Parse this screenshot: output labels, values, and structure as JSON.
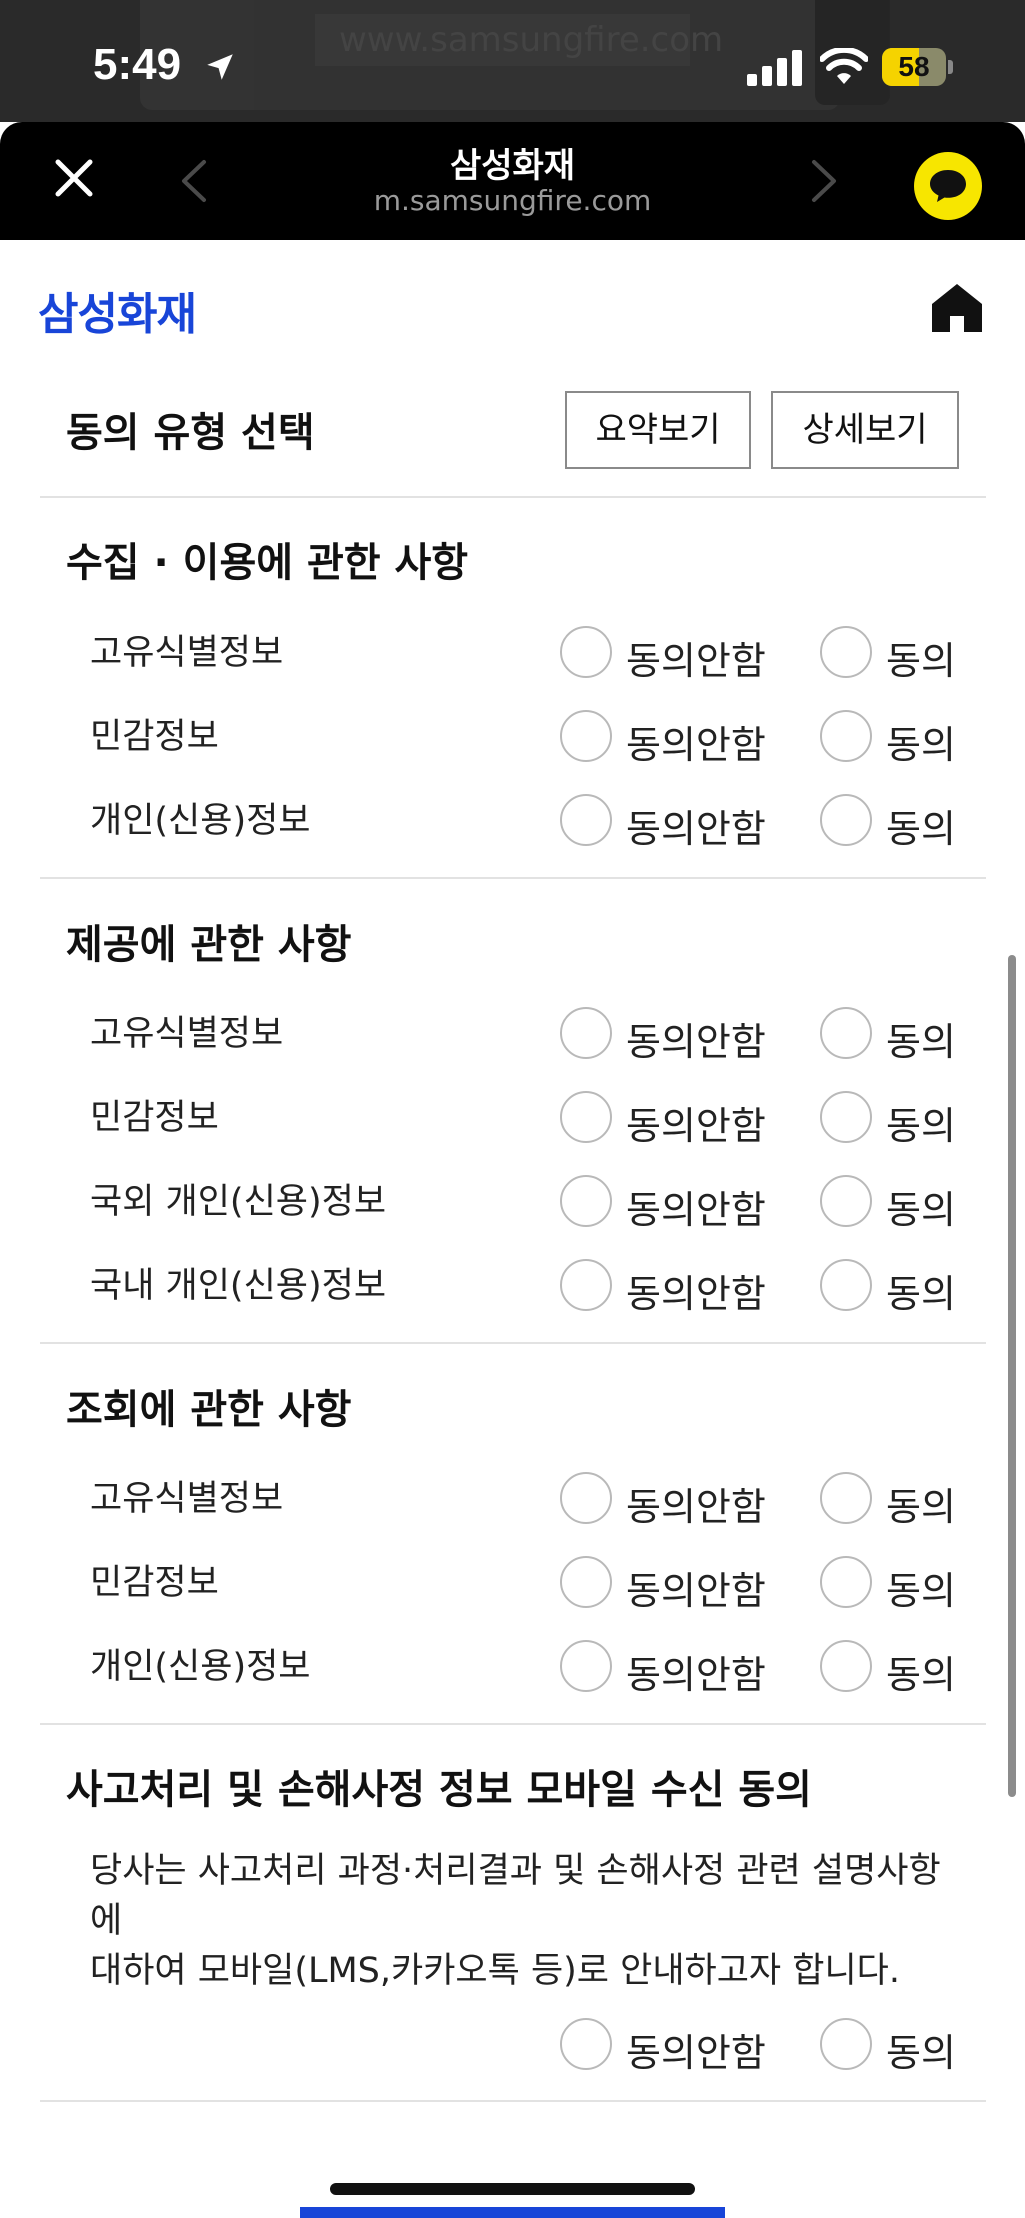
{
  "status_bar": {
    "time": "5:49",
    "battery_percent": "58",
    "battery_level": 0.58,
    "ghost_url": "www.samsungfire.com"
  },
  "browser": {
    "title": "삼성화재",
    "url": "m.samsungfire.com",
    "accent_color": "#f7e600"
  },
  "page": {
    "logo": "삼성화재",
    "brand_color": "#1845d8"
  },
  "consent_type": {
    "title": "동의 유형 선택",
    "summary_button": "요약보기",
    "detail_button": "상세보기"
  },
  "options": {
    "disagree": "동의안함",
    "agree": "동의"
  },
  "sections": [
    {
      "title": "수집 · 이용에 관한 사항",
      "rows": [
        "고유식별정보",
        "민감정보",
        "개인(신용)정보"
      ]
    },
    {
      "title": "제공에 관한 사항",
      "rows": [
        "고유식별정보",
        "민감정보",
        "국외 개인(신용)정보",
        "국내 개인(신용)정보"
      ]
    },
    {
      "title": "조회에 관한 사항",
      "rows": [
        "고유식별정보",
        "민감정보",
        "개인(신용)정보"
      ]
    }
  ],
  "mobile_consent": {
    "title": "사고처리 및 손해사정 정보 모바일 수신 동의",
    "notice_line1": "당사는 사고처리 과정·처리결과 및 손해사정 관련 설명사항에",
    "notice_line2": "대하여 모바일(LMS,카카오톡 등)로 안내하고자 합니다."
  }
}
